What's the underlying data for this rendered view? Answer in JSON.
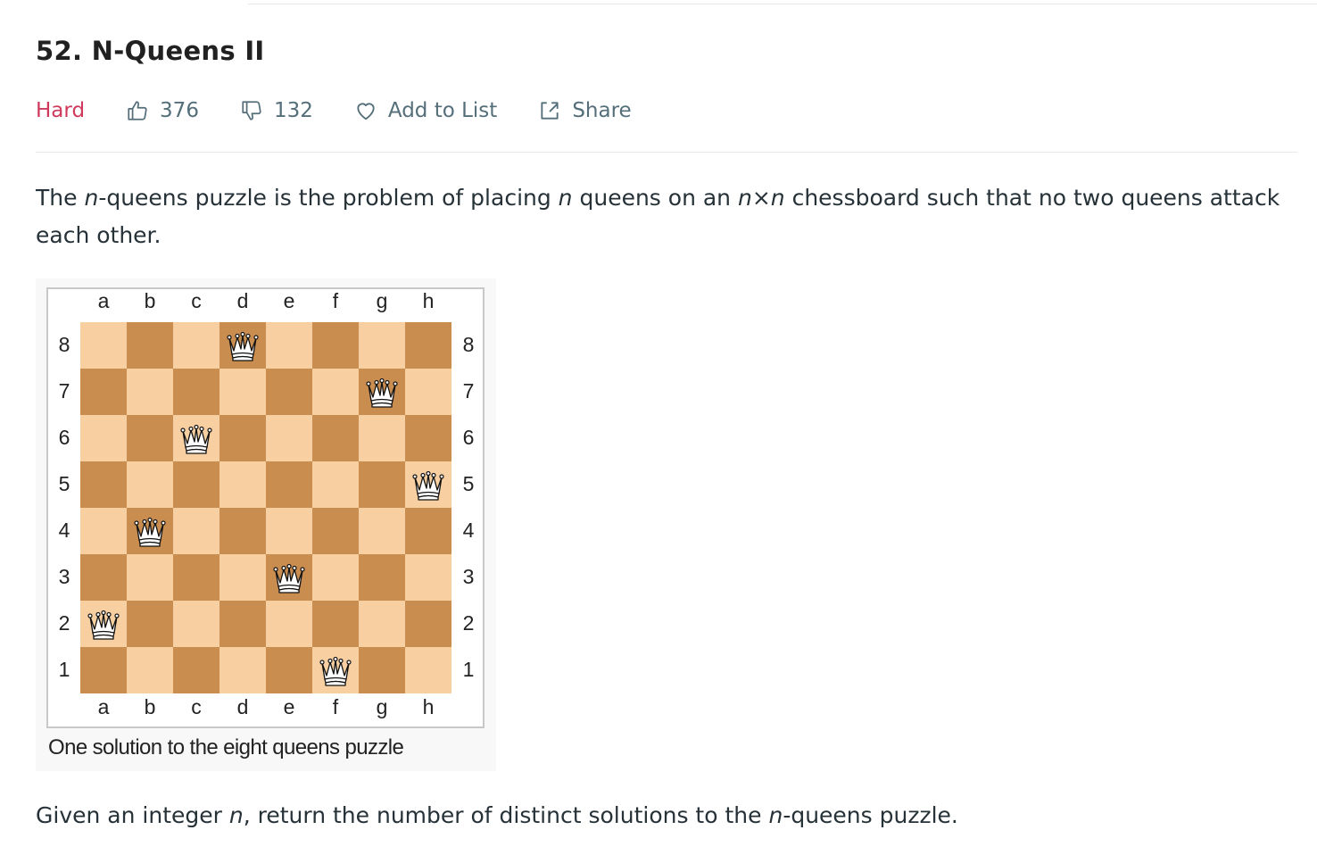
{
  "problem": {
    "title": "52. N-Queens II",
    "difficulty": "Hard",
    "likes": "376",
    "dislikes": "132",
    "add_to_list": "Add to List",
    "share": "Share"
  },
  "description": {
    "p1_a": "The ",
    "p1_n1": "n",
    "p1_b": "-queens puzzle is the problem of placing ",
    "p1_n2": "n",
    "p1_c": " queens on an ",
    "p1_n3": "n",
    "p1_x": "×",
    "p1_n4": "n",
    "p1_d": " chessboard such that no two queens attack each other.",
    "p2_a": "Given an integer ",
    "p2_n1": "n",
    "p2_b": ", return the number of distinct solutions to the ",
    "p2_n2": "n",
    "p2_c": "-queens puzzle."
  },
  "figure": {
    "caption": "One solution to the eight queens puzzle",
    "files": [
      "a",
      "b",
      "c",
      "d",
      "e",
      "f",
      "g",
      "h"
    ],
    "ranks": [
      "8",
      "7",
      "6",
      "5",
      "4",
      "3",
      "2",
      "1"
    ],
    "queens": [
      "d8",
      "g7",
      "c6",
      "h5",
      "b4",
      "e3",
      "a2",
      "f1"
    ],
    "light_color": "#f7cfa1",
    "dark_color": "#c98d50"
  },
  "colors": {
    "hard": "#d0385c",
    "meta_text": "#546e7a"
  }
}
